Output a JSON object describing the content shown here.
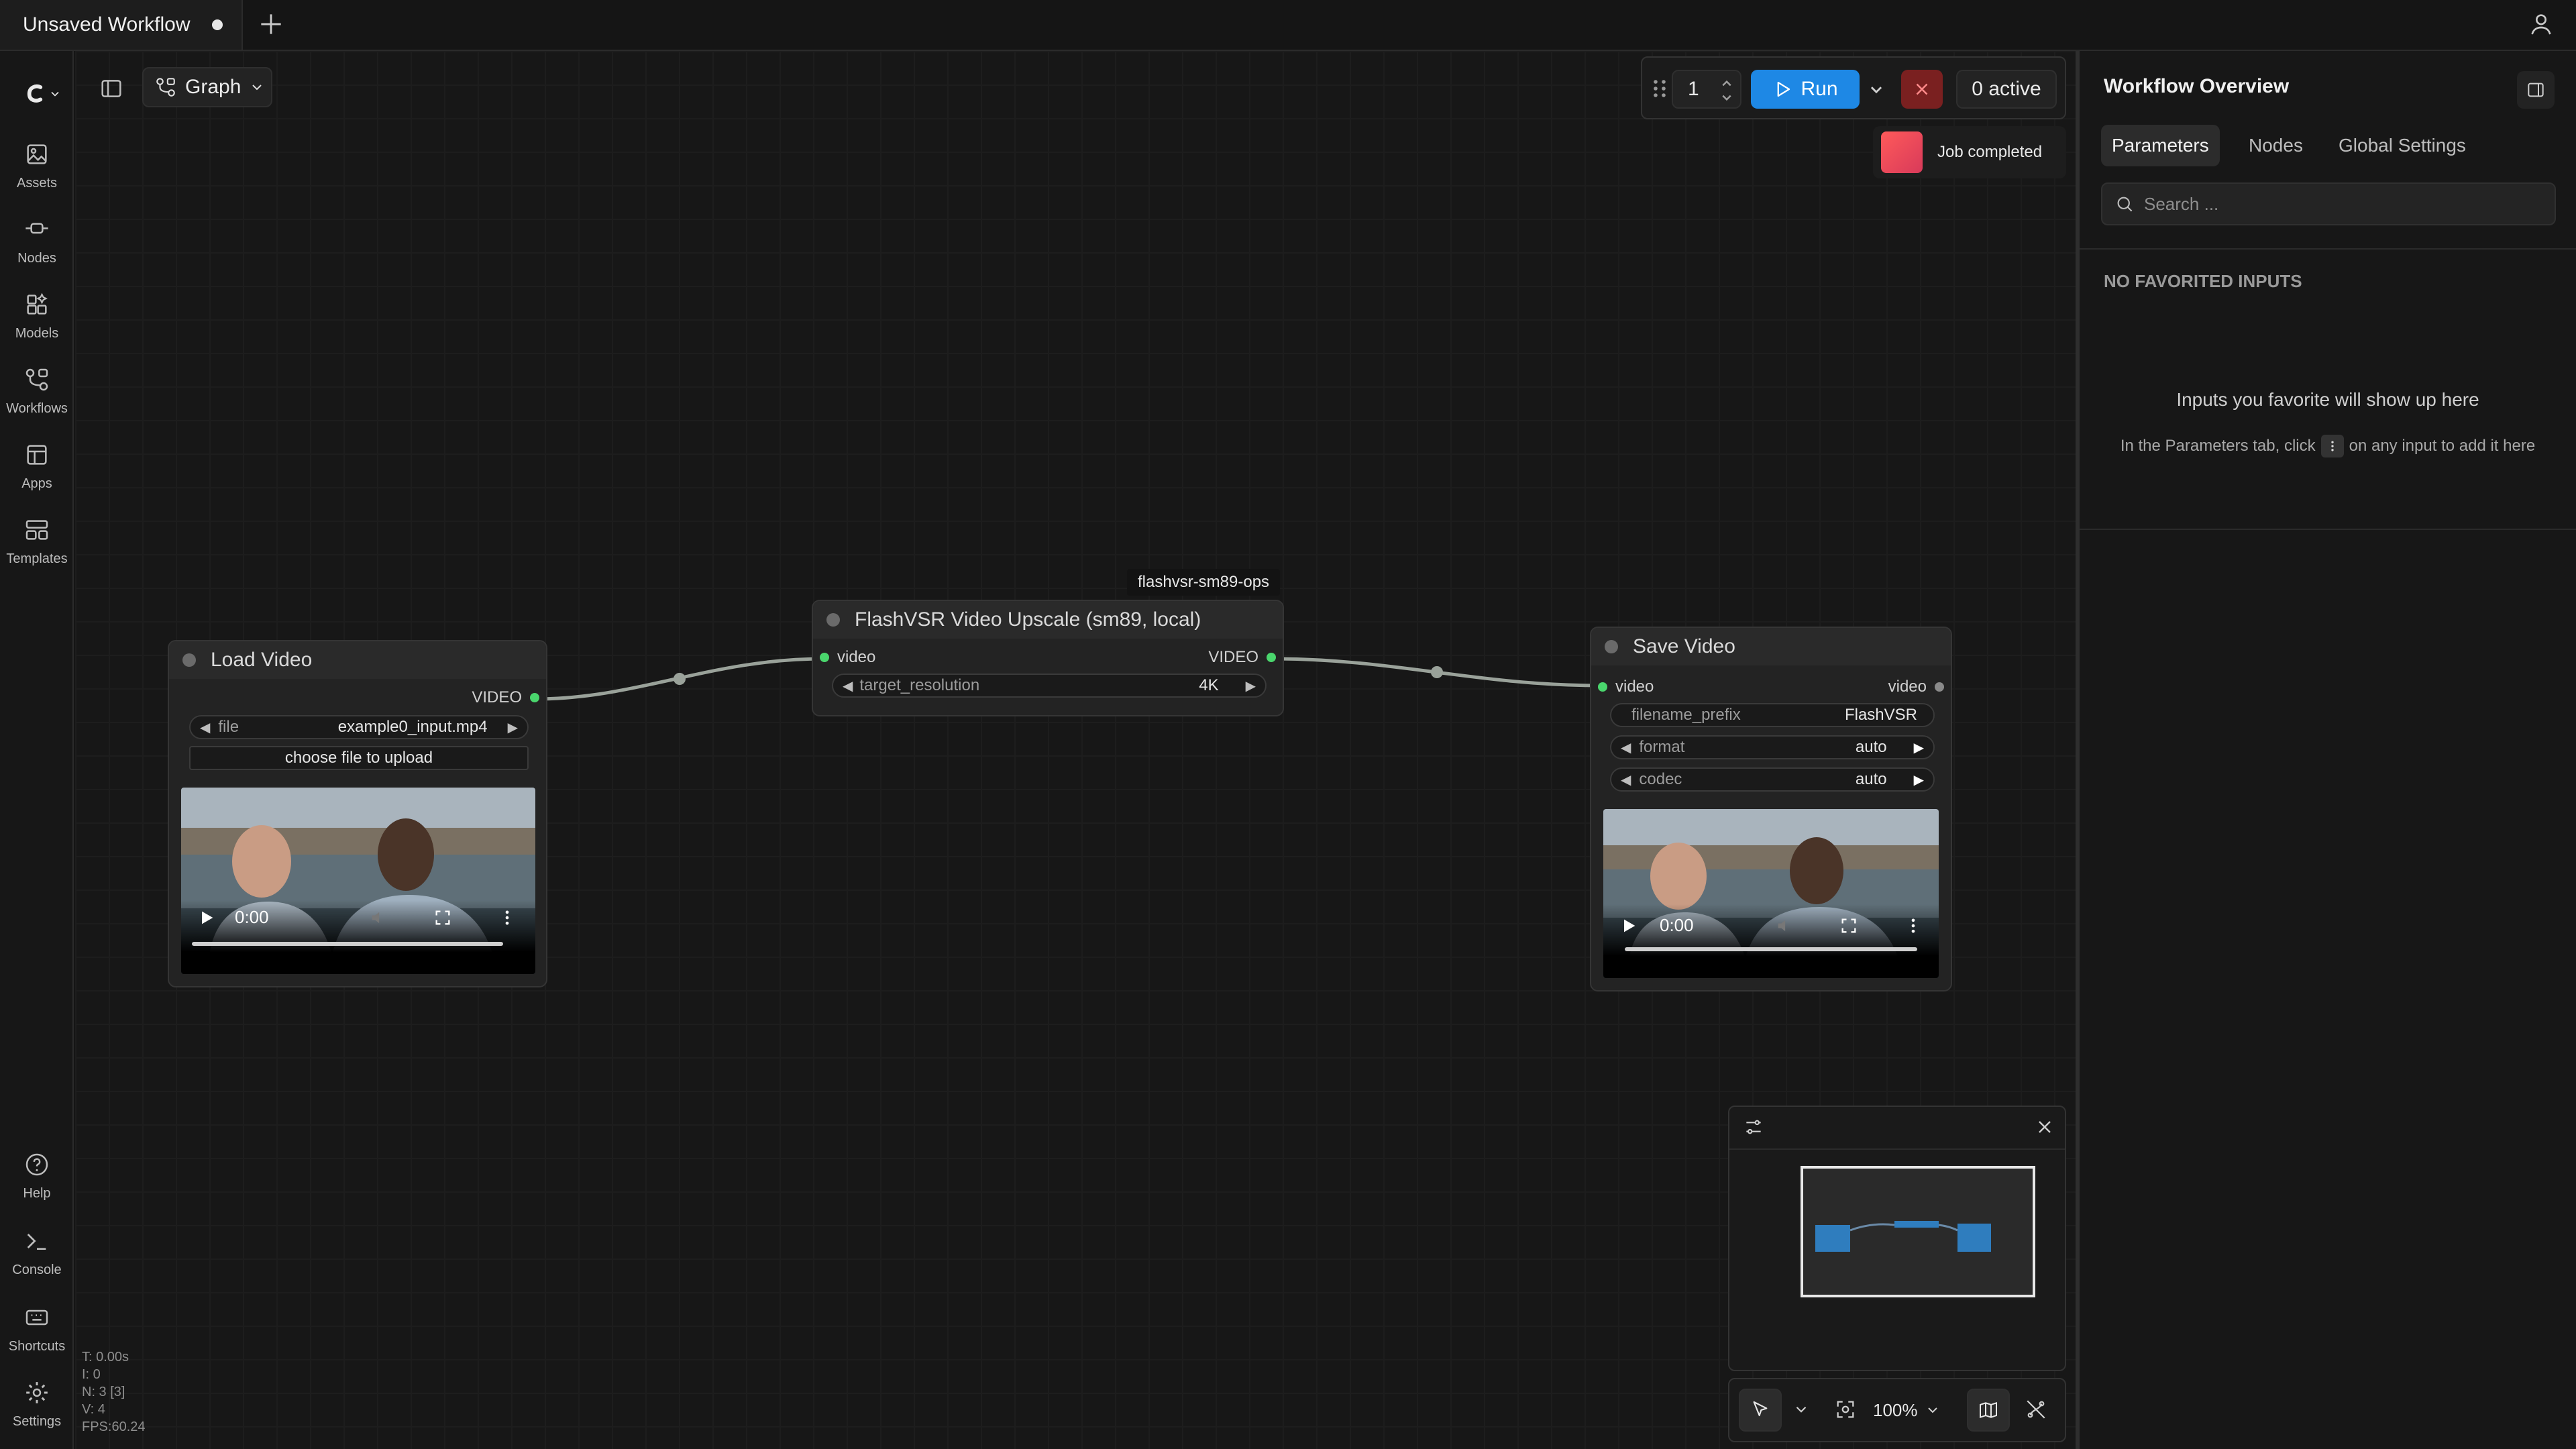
{
  "tabs": {
    "active_title": "Unsaved Workflow"
  },
  "sidebar": {
    "items": [
      {
        "label": "Assets",
        "icon": "image-icon"
      },
      {
        "label": "Nodes",
        "icon": "node-icon"
      },
      {
        "label": "Models",
        "icon": "models-icon"
      },
      {
        "label": "Workflows",
        "icon": "workflow-icon"
      },
      {
        "label": "Apps",
        "icon": "apps-icon"
      },
      {
        "label": "Templates",
        "icon": "templates-icon"
      }
    ],
    "bottom": [
      {
        "label": "Help",
        "icon": "help-icon"
      },
      {
        "label": "Console",
        "icon": "console-icon"
      },
      {
        "label": "Shortcuts",
        "icon": "keyboard-icon"
      },
      {
        "label": "Settings",
        "icon": "gear-icon"
      }
    ]
  },
  "toolbar": {
    "view_mode": "Graph",
    "batch_count": "1",
    "run_label": "Run",
    "active_label": "0 active",
    "toast": "Job completed"
  },
  "nodes": {
    "load_video": {
      "title": "Load Video",
      "output_label": "VIDEO",
      "file_label": "file",
      "file_value": "example0_input.mp4",
      "upload_label": "choose file to upload",
      "time": "0:00"
    },
    "flashvsr": {
      "title": "FlashVSR Video Upscale (sm89, local)",
      "tag": "flashvsr-sm89-ops",
      "input_label": "video",
      "output_label": "VIDEO",
      "res_label": "target_resolution",
      "res_value": "4K"
    },
    "save_video": {
      "title": "Save Video",
      "input_label": "video",
      "output_label": "video",
      "prefix_label": "filename_prefix",
      "prefix_value": "FlashVSR",
      "format_label": "format",
      "format_value": "auto",
      "codec_label": "codec",
      "codec_value": "auto",
      "time": "0:00"
    }
  },
  "canvas_controls": {
    "zoom": "100%"
  },
  "stats": {
    "t": "T: 0.00s",
    "i": "I: 0",
    "n": "N: 3 [3]",
    "v": "V: 4",
    "fps": "FPS:60.24"
  },
  "right_panel": {
    "title": "Workflow Overview",
    "tabs": [
      "Parameters",
      "Nodes",
      "Global Settings"
    ],
    "search_placeholder": "Search ...",
    "no_fav": "NO FAVORITED INPUTS",
    "hint_title": "Inputs you favorite will show up here",
    "hint_pre": "In the Parameters tab, click",
    "hint_post": "on any input to add it here"
  },
  "colors": {
    "accent": "#1e88e5",
    "slot": "#4ad66d",
    "cancel": "#7a2020"
  }
}
